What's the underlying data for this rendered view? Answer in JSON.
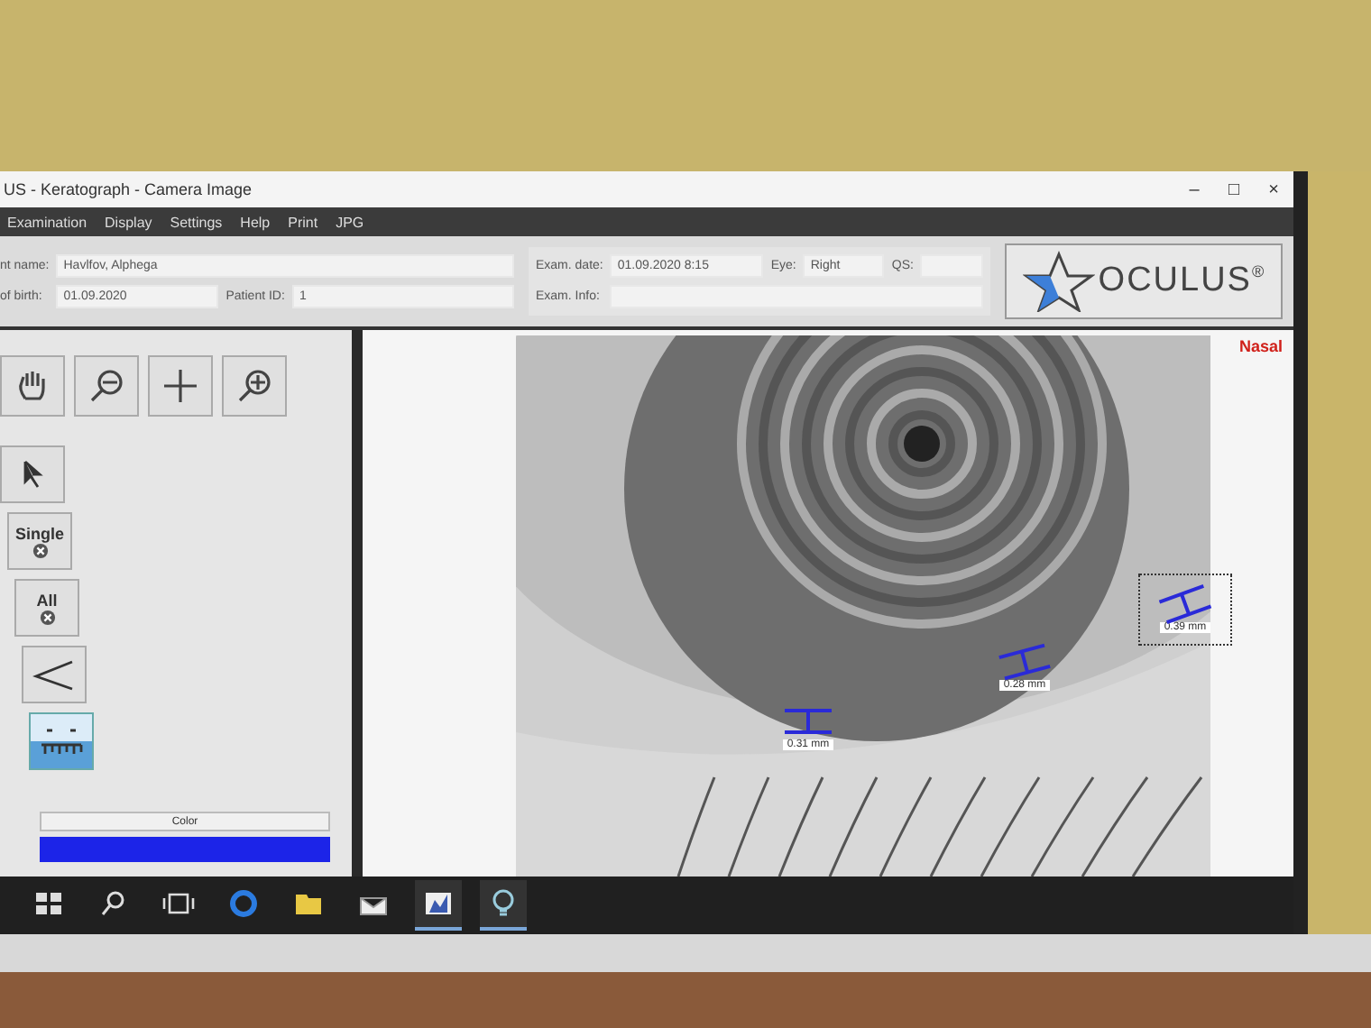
{
  "window": {
    "title": "US - Keratograph - Camera Image",
    "controls": [
      "–",
      "□",
      "×"
    ]
  },
  "menu": [
    "Examination",
    "Display",
    "Settings",
    "Help",
    "Print",
    "JPG"
  ],
  "patient": {
    "fields": [
      {
        "label": "nt name:",
        "value": "Havlfov, Alphega"
      },
      {
        "label": "of birth:",
        "value": "01.09.2020"
      },
      {
        "label": "Patient ID:",
        "value": "1"
      }
    ]
  },
  "exam": {
    "fields": [
      {
        "label": "Exam. date:",
        "value": "01.09.2020 8:15"
      },
      {
        "label": "Eye:",
        "value": "Right"
      },
      {
        "label": "QS:"
      },
      {
        "label": "Exam. Info:"
      }
    ]
  },
  "logo": {
    "text": "OCULUS",
    "mark": "®"
  },
  "view_tools": [
    {
      "kind": "hand"
    },
    {
      "kind": "zoom-out"
    },
    {
      "kind": "crosshair"
    },
    {
      "kind": "zoom-in"
    }
  ],
  "measure_tools": [
    {
      "kind": "pointer",
      "selected": false
    },
    {
      "kind": "text",
      "label": "Single",
      "selected": false
    },
    {
      "kind": "text",
      "label": "All",
      "selected": false
    },
    {
      "kind": "angle",
      "selected": false
    },
    {
      "kind": "ruler",
      "selected": true
    }
  ],
  "color_button": "Color",
  "color_swatch": {
    "color": "#1c24e8"
  },
  "image": {
    "side_label": "Nasal",
    "measurements": [
      {
        "label": "0.31 mm",
        "selected": false
      },
      {
        "label": "0.28 mm",
        "selected": false
      },
      {
        "label": "0.39 mm",
        "selected": true
      }
    ]
  },
  "taskbar": [
    {
      "kind": "start",
      "active": false
    },
    {
      "kind": "search",
      "active": false
    },
    {
      "kind": "task-view",
      "active": false
    },
    {
      "kind": "browser",
      "active": false
    },
    {
      "kind": "folder",
      "active": false
    },
    {
      "kind": "mail",
      "active": false
    },
    {
      "kind": "chart",
      "active": true
    },
    {
      "kind": "bulb",
      "active": true
    }
  ]
}
